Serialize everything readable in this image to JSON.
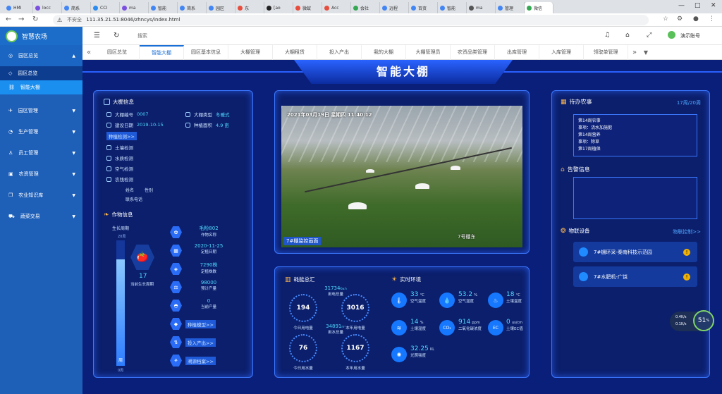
{
  "browser": {
    "tabs": [
      "HMI",
      "locc",
      "简系",
      "CCI",
      "ma",
      "智能",
      "简系",
      "园区",
      "东",
      "[ao",
      "微蚁",
      "Acc",
      "会社",
      "远程",
      "百资",
      "智能",
      "ma",
      "管理",
      "微信"
    ],
    "url_prefix": "不安全",
    "url": "111.35.21.51:8046/zhncys/index.html"
  },
  "sidebar": {
    "app_title": "智慧农场",
    "menus": [
      {
        "label": "园区总览",
        "arrow": "▲"
      },
      {
        "label": "园区总览",
        "sub": true
      },
      {
        "label": "智能大棚",
        "sub": true,
        "active": true
      },
      {
        "label": "园区管理",
        "arrow": "▼"
      },
      {
        "label": "生产管理",
        "arrow": "▼"
      },
      {
        "label": "员工管理",
        "arrow": "▼"
      },
      {
        "label": "农资管理",
        "arrow": "▼"
      },
      {
        "label": "农业知识库",
        "arrow": "▼"
      },
      {
        "label": "蔬菜交易",
        "arrow": "▼"
      }
    ]
  },
  "topbar": {
    "search_placeholder": "搜索",
    "user": "演示账号"
  },
  "page_tabs": [
    "园区总览",
    "智能大棚",
    "园区基本信息",
    "大棚管理",
    "大棚租赁",
    "投入产出",
    "我的大棚",
    "大棚管理员",
    "农资品类管理",
    "出库管理",
    "入库管理",
    "领取单管理"
  ],
  "dashboard": {
    "title": "智能大棚",
    "greenhouse": {
      "header": "大棚信息",
      "code_label": "大棚编号",
      "code": "0007",
      "type_label": "大棚类型",
      "type": "冬暖式",
      "date_label": "建设日期",
      "date": "2019-10-15",
      "area_label": "种植面积",
      "area": "4.9 亩",
      "detect_btn": "种植检测>>",
      "checks": [
        "土壤检测",
        "水质检测",
        "空气检测",
        "农残检测"
      ],
      "name_label": "姓名",
      "gender_label": "性别",
      "phone_label": "联系电话"
    },
    "crop": {
      "header": "作物信息",
      "cycle_label": "生长周期",
      "cycle_total": "20周",
      "cycle_start": "0周",
      "cycle_progress": 0.85,
      "cycle_bottom": "周",
      "current_week": "17",
      "current_week_label": "当前生长周期",
      "items": [
        {
          "value": "毛粉802",
          "label": "作物名称"
        },
        {
          "value": "2020-11-25",
          "label": "定植日期"
        },
        {
          "value": "7290株",
          "label": "定植株数"
        },
        {
          "value": "98000",
          "label": "预计产量"
        },
        {
          "value": "0",
          "label": "当前产量"
        }
      ],
      "buttons": [
        "种植模型>>",
        "投入产出>>",
        "溯源档案>>"
      ]
    },
    "video": {
      "timestamp": "2021年03月19日  星期四  11:40:12",
      "caption": "7#棚监控画面",
      "cam_label": "7号棚东"
    },
    "energy": {
      "header": "耗能总汇",
      "total_power": "31734",
      "total_power_unit": "Kw.h",
      "total_power_label": "用电总量",
      "month_power": "194",
      "month_power_label": "今日用电量",
      "year_power": "3016",
      "year_power_label": "本年用电量",
      "total_water": "34891",
      "total_water_unit": "m³",
      "total_water_label": "用水总量",
      "month_water": "76",
      "month_water_label": "今日用水量",
      "year_water": "1167",
      "year_water_label": "本年用水量"
    },
    "env": {
      "header": "实时环境",
      "items": [
        {
          "value": "33",
          "unit": "°C",
          "label": "空气温度"
        },
        {
          "value": "53.2",
          "unit": "%",
          "label": "空气湿度"
        },
        {
          "value": "18",
          "unit": "°C",
          "label": "土壤温度"
        },
        {
          "value": "14",
          "unit": "%",
          "label": "土壤湿度"
        },
        {
          "value": "914",
          "unit": "ppm",
          "label": "二氧化碳浓度"
        },
        {
          "value": "0",
          "unit": "us/cm",
          "label": "土壤EC值"
        },
        {
          "value": "32.25",
          "unit": "KL",
          "label": "光照强度"
        }
      ]
    },
    "todo": {
      "header": "待办农事",
      "count": "17周/20周",
      "items": [
        "第14周农事",
        "事项：浇水加施肥",
        "第14周营养",
        "事项：除草",
        "第17周植保"
      ]
    },
    "alert": {
      "header": "告警信息"
    },
    "devices": {
      "header": "物联设备",
      "link": "物联控制>>",
      "items": [
        "7#棚环采-秦南科技示范园",
        "7#水肥机-广饶"
      ]
    },
    "widget": {
      "percent": "51",
      "up": "0.4K/s",
      "down": "0.1K/s"
    }
  }
}
